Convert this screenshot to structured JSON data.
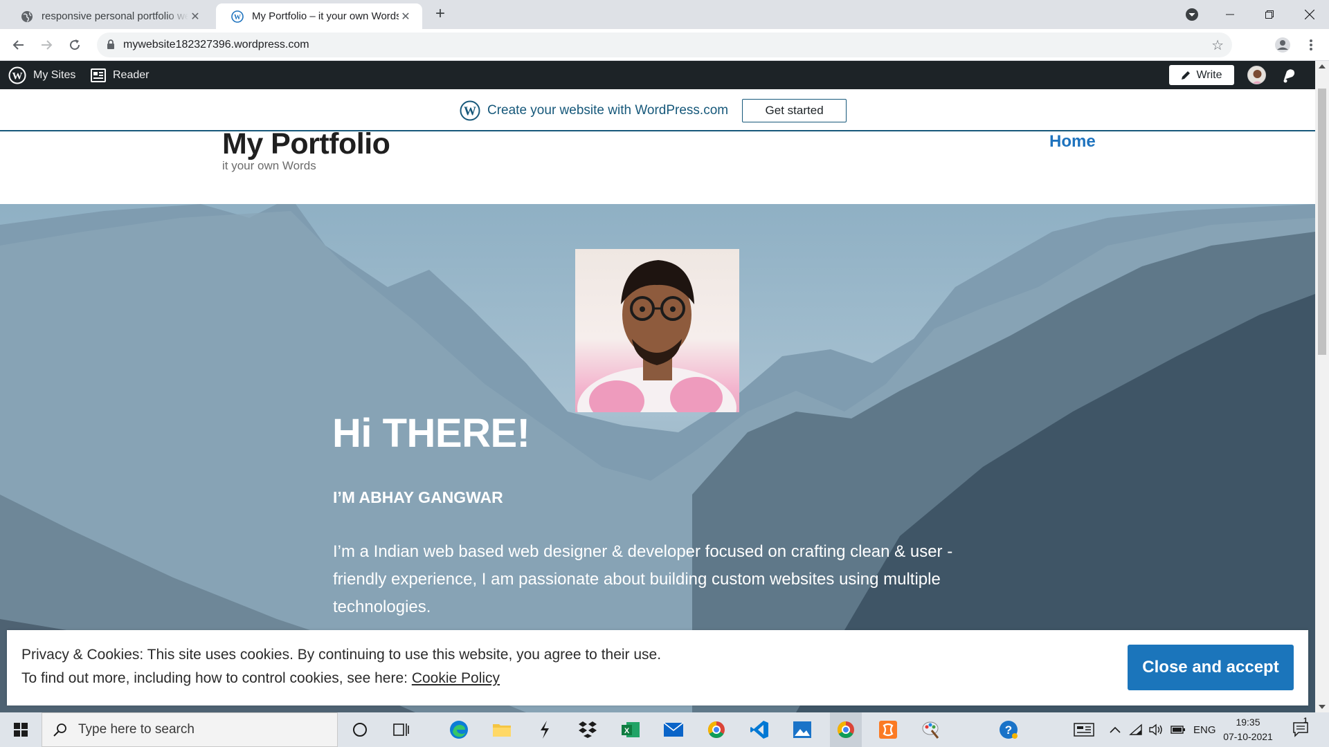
{
  "browser": {
    "tabs": [
      {
        "title": "responsive personal portfolio website",
        "active": false
      },
      {
        "title": "My Portfolio – it your own Words",
        "active": true
      }
    ],
    "url": "mywebsite182327396.wordpress.com"
  },
  "wp_admin_bar": {
    "my_sites": "My Sites",
    "reader": "Reader",
    "write": "Write"
  },
  "banner": {
    "text": "Create your website with WordPress.com",
    "cta": "Get started"
  },
  "site": {
    "title": "My Portfolio",
    "tagline": "it your own Words",
    "nav": [
      "Home"
    ]
  },
  "hero": {
    "greeting": "Hi THERE!",
    "name": "I’M ABHAY GANGWAR",
    "intro": "I’m a Indian web based web designer & developer focused on crafting clean & user - friendly experience, I am passionate about building custom websites using multiple technologies."
  },
  "cookie_notice": {
    "line1": "Privacy & Cookies: This site uses cookies. By continuing to use this website, you agree to their use.",
    "line2_prefix": "To find out more, including how to control cookies, see here: ",
    "link": "Cookie Policy",
    "button": "Close and accept"
  },
  "taskbar": {
    "search_placeholder": "Type here to search",
    "language": "ENG",
    "time": "19:35",
    "date": "07-10-2021",
    "notification_count": "1"
  },
  "colors": {
    "wp_blue": "#16587a",
    "link_blue": "#1e73be",
    "button_blue": "#1b75bb",
    "admin_bar": "#1d2327"
  }
}
